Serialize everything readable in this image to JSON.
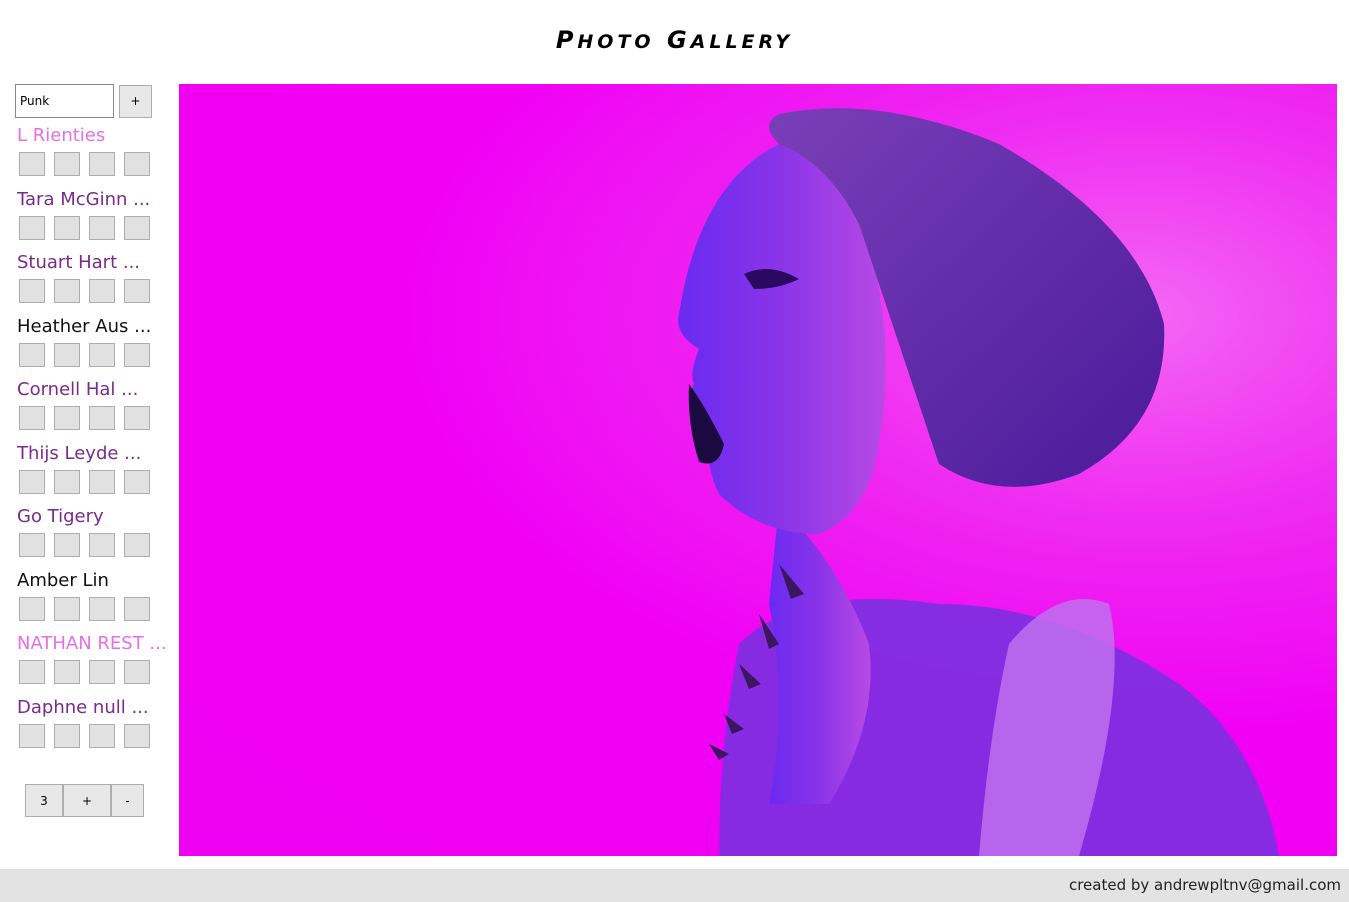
{
  "header": {
    "title_first_initial": "P",
    "title_first_rest": "HOTO",
    "title_second_initial": "G",
    "title_second_rest": "ALLERY"
  },
  "search": {
    "value": "Punk",
    "add_label": "+"
  },
  "authors": [
    {
      "name": "L Rienties",
      "color": "#e86ee8"
    },
    {
      "name": "Tara McGinn ...",
      "color": "#7a2a88"
    },
    {
      "name": "Stuart Hart ...",
      "color": "#7a2a88"
    },
    {
      "name": "Heather Aus ...",
      "color": "#111111"
    },
    {
      "name": "Cornell Hal ...",
      "color": "#7a2a88"
    },
    {
      "name": "Thijs Leyde ...",
      "color": "#7a2a88"
    },
    {
      "name": "Go Tigery",
      "color": "#7a2a88"
    },
    {
      "name": "Amber Lin",
      "color": "#111111"
    },
    {
      "name": "NATHAN REST ...",
      "color": "#e86ee8"
    },
    {
      "name": "Daphne null ...",
      "color": "#7a2a88"
    }
  ],
  "thumbs_per_author": 4,
  "pager": {
    "count": "3",
    "plus_label": "+",
    "minus_label": "-"
  },
  "main_photo": {
    "icon": "punk-portrait-photo",
    "tint_color": "#f000f5"
  },
  "footer": {
    "credit": "created by andrewpltnv@gmail.com"
  }
}
